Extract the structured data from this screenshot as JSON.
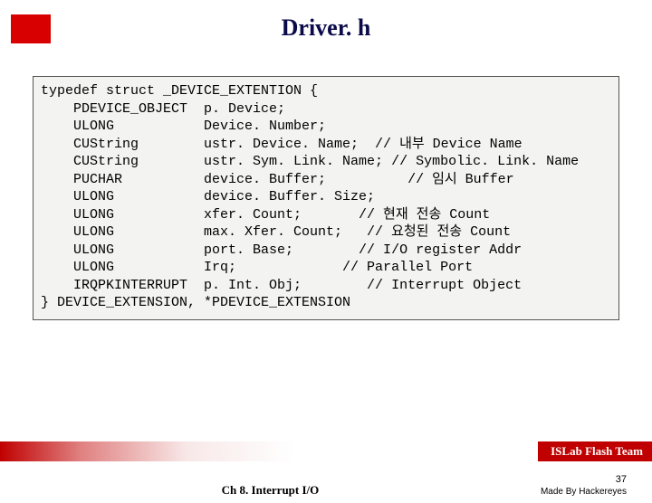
{
  "title": "Driver. h",
  "code": {
    "l0": "typedef struct _DEVICE_EXTENTION {",
    "l1": "    PDEVICE_OBJECT  p. Device;",
    "l2": "    ULONG           Device. Number;",
    "l3": "    CUString        ustr. Device. Name;  // 내부 Device Name",
    "l4": "    CUString        ustr. Sym. Link. Name; // Symbolic. Link. Name",
    "l5": "    PUCHAR          device. Buffer;          // 임시 Buffer",
    "l6": "    ULONG           device. Buffer. Size;",
    "l7": "    ULONG           xfer. Count;       // 현재 전송 Count",
    "l8": "    ULONG           max. Xfer. Count;   // 요청된 전송 Count",
    "l9": "    ULONG           port. Base;        // I/O register Addr",
    "l10": "    ULONG           Irq;             // Parallel Port",
    "l11": "    IRQPKINTERRUPT  p. Int. Obj;        // Interrupt Object",
    "l12": "} DEVICE_EXTENSION, *PDEVICE_EXTENSION"
  },
  "team": "ISLab Flash Team",
  "chapter": "Ch 8. Interrupt I/O",
  "page": "37",
  "madeby": "Made By Hackereyes"
}
